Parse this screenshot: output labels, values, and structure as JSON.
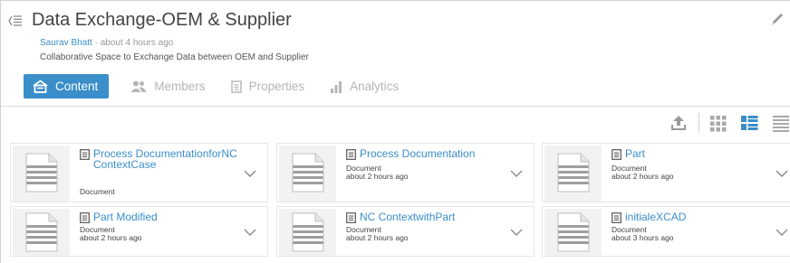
{
  "header": {
    "title": "Data Exchange-OEM & Supplier",
    "author": "Saurav Bhatt",
    "time": "about 4 hours ago",
    "description": "Collaborative Space to Exchange Data between OEM and Supplier"
  },
  "tabs": [
    {
      "label": "Content",
      "icon": "content-icon",
      "active": true
    },
    {
      "label": "Members",
      "icon": "members-icon",
      "active": false
    },
    {
      "label": "Properties",
      "icon": "properties-icon",
      "active": false
    },
    {
      "label": "Analytics",
      "icon": "analytics-icon",
      "active": false
    }
  ],
  "toolbar": {
    "icons": [
      "upload-icon",
      "thumbnail-grid-icon",
      "tile-view-icon",
      "list-view-icon"
    ]
  },
  "cards": [
    {
      "name": "Process DocumentationforNCContextCase",
      "type": "Document",
      "time": ""
    },
    {
      "name": "Process Documentation",
      "type": "Document",
      "time": "about 2 hours ago"
    },
    {
      "name": "Part",
      "type": "Document",
      "time": "about 2 hours ago"
    },
    {
      "name": "Part Modified",
      "type": "Document",
      "time": "about 2 hours ago"
    },
    {
      "name": "NC ContextwithPart",
      "type": "Document",
      "time": "about 2 hours ago"
    },
    {
      "name": "initialeXCAD",
      "type": "Document",
      "time": "about 3 hours ago"
    }
  ],
  "colors": {
    "accent": "#3a8ec9",
    "muted": "#b5b5b5"
  }
}
